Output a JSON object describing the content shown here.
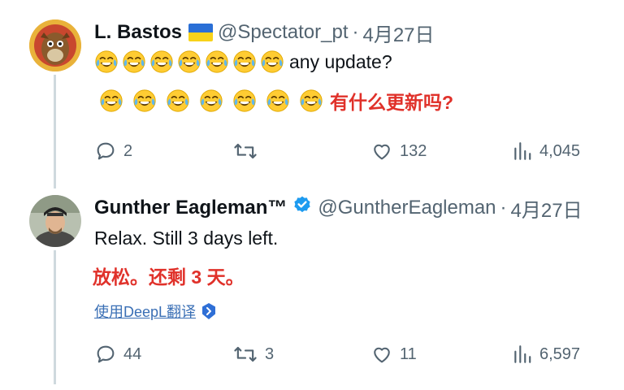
{
  "tweet1": {
    "name": "L. Bastos",
    "handle": "@Spectator_pt",
    "time": "4月27日",
    "text": "any update?",
    "emoji_count": 7,
    "translation": "有什么更新吗?",
    "actions": {
      "replies": "2",
      "retweets": "",
      "likes": "132",
      "views": "4,045"
    }
  },
  "tweet2": {
    "name": "Gunther Eagleman™",
    "handle": "@GuntherEagleman",
    "time": "4月27日",
    "text": "Relax.  Still 3 days left.",
    "translation": "放松。还剩 3 天。",
    "translate_link": "使用DeepL翻译",
    "actions": {
      "replies": "44",
      "retweets": "3",
      "likes": "11",
      "views": "6,597"
    }
  },
  "separator": "·",
  "colors": {
    "name": "#0f1419",
    "secondary": "#536471",
    "translation": "#e0312a",
    "link": "#3a6fb5",
    "verified": "#1d9bf0"
  },
  "icons": [
    "reply-icon",
    "retweet-icon",
    "like-icon",
    "views-icon",
    "verified-icon",
    "ukraine-flag-icon",
    "laugh-cry-emoji",
    "deepl-icon"
  ]
}
